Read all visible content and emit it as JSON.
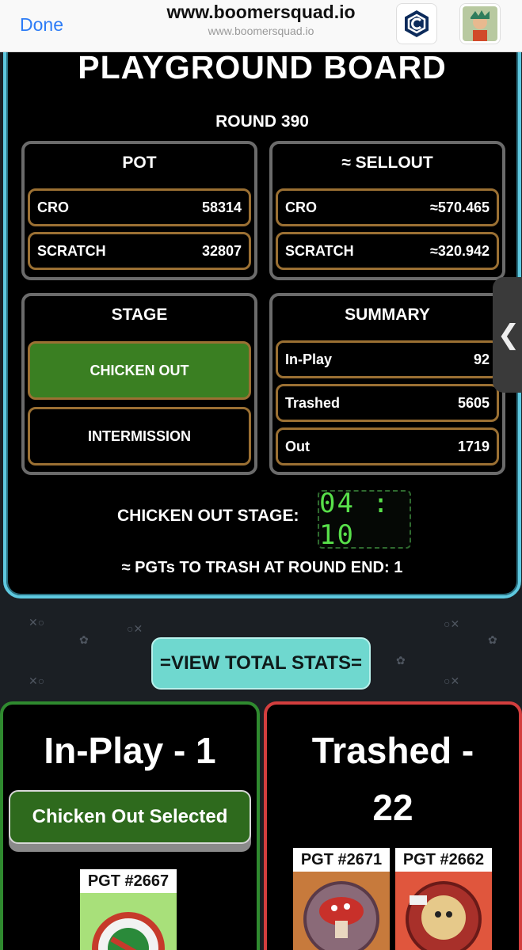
{
  "browser": {
    "done_label": "Done",
    "url_title": "www.boomersquad.io",
    "url_subtitle": "www.boomersquad.io",
    "icons": [
      "crypto-com-wallet-icon",
      "profile-avatar-icon"
    ]
  },
  "board": {
    "title": "PLAYGROUND BOARD",
    "round": "ROUND 390",
    "pot": {
      "title": "POT",
      "rows": [
        {
          "label": "CRO",
          "value": "58314"
        },
        {
          "label": "SCRATCH",
          "value": "32807"
        }
      ]
    },
    "sellout": {
      "title": "≈ SELLOUT",
      "rows": [
        {
          "label": "CRO",
          "value": "≈570.465"
        },
        {
          "label": "SCRATCH",
          "value": "≈320.942"
        }
      ]
    },
    "stage": {
      "title": "STAGE",
      "options": [
        "CHICKEN OUT",
        "INTERMISSION"
      ],
      "active": "CHICKEN OUT"
    },
    "summary": {
      "title": "SUMMARY",
      "rows": [
        {
          "label": "In-Play",
          "value": "92"
        },
        {
          "label": "Trashed",
          "value": "5605"
        },
        {
          "label": "Out",
          "value": "1719"
        }
      ]
    },
    "timer_label": "CHICKEN OUT STAGE:",
    "timer_value": "04 : 10",
    "trash_line": "≈ PGTs TO TRASH AT ROUND END: 1",
    "side_tab_icon": "chevron-left-icon"
  },
  "stats_button": "=VIEW TOTAL STATS=",
  "inplay": {
    "heading": "In-Play - 1",
    "button": "Chicken Out Selected",
    "cards": [
      {
        "label": "PGT #2667",
        "color": "#a8e07a"
      }
    ]
  },
  "trashed": {
    "heading_line1": "Trashed -",
    "heading_line2": "22",
    "cards": [
      {
        "label": "PGT #2671",
        "color": "#c77a3c"
      },
      {
        "label": "PGT #2662",
        "color": "#e0563d"
      }
    ]
  },
  "colors": {
    "accent_cyan": "#5ec8df",
    "stage_active": "#3a7f22",
    "row_border": "#9b7033",
    "inplay_border": "#2f8a2f",
    "trashed_border": "#d33e3e",
    "stats_button": "#6fd8cf"
  }
}
